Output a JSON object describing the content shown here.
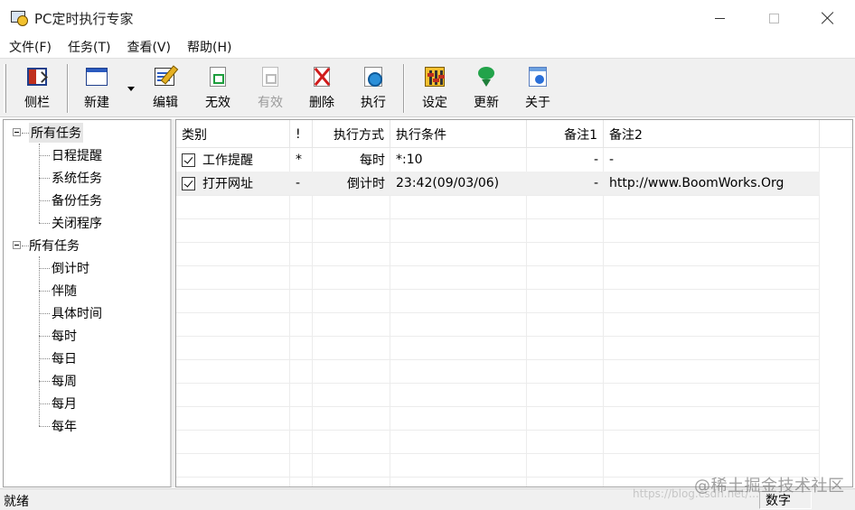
{
  "window": {
    "title": "PC定时执行专家"
  },
  "menubar": {
    "items": [
      "文件(F)",
      "任务(T)",
      "查看(V)",
      "帮助(H)"
    ]
  },
  "toolbar": {
    "buttons": [
      {
        "label": "侧栏",
        "icon": "sidebar-icon",
        "enabled": true
      },
      {
        "label": "新建",
        "icon": "new-window-icon",
        "enabled": true
      },
      {
        "label": "编辑",
        "icon": "edit-icon",
        "enabled": true
      },
      {
        "label": "无效",
        "icon": "disable-icon",
        "enabled": true
      },
      {
        "label": "有效",
        "icon": "enable-icon",
        "enabled": false
      },
      {
        "label": "删除",
        "icon": "delete-icon",
        "enabled": true
      },
      {
        "label": "执行",
        "icon": "execute-icon",
        "enabled": true
      },
      {
        "label": "设定",
        "icon": "settings-icon",
        "enabled": true
      },
      {
        "label": "更新",
        "icon": "update-icon",
        "enabled": true
      },
      {
        "label": "关于",
        "icon": "about-icon",
        "enabled": true
      }
    ]
  },
  "tree": {
    "groups": [
      {
        "label": "所有任务",
        "children": [
          "日程提醒",
          "系统任务",
          "备份任务",
          "关闭程序"
        ]
      },
      {
        "label": "所有任务",
        "children": [
          "倒计时",
          "伴随",
          "具体时间",
          "每时",
          "每日",
          "每周",
          "每月",
          "每年"
        ]
      }
    ]
  },
  "list": {
    "columns": [
      "类别",
      "!",
      "执行方式",
      "执行条件",
      "备注1",
      "备注2"
    ],
    "rows": [
      {
        "checked": true,
        "category": "工作提醒",
        "priority": "*",
        "mode": "每时",
        "condition": "*:10",
        "note1": "-",
        "note2": "-"
      },
      {
        "checked": true,
        "category": "打开网址",
        "priority": "-",
        "mode": "倒计时",
        "condition": "23:42(09/03/06)",
        "note1": "-",
        "note2": "http://www.BoomWorks.Org"
      }
    ]
  },
  "statusbar": {
    "left": "就绪",
    "right": "数字"
  },
  "watermark": {
    "text": "@稀土掘金技术社区",
    "url": "https://blog.csdn.net/..."
  }
}
